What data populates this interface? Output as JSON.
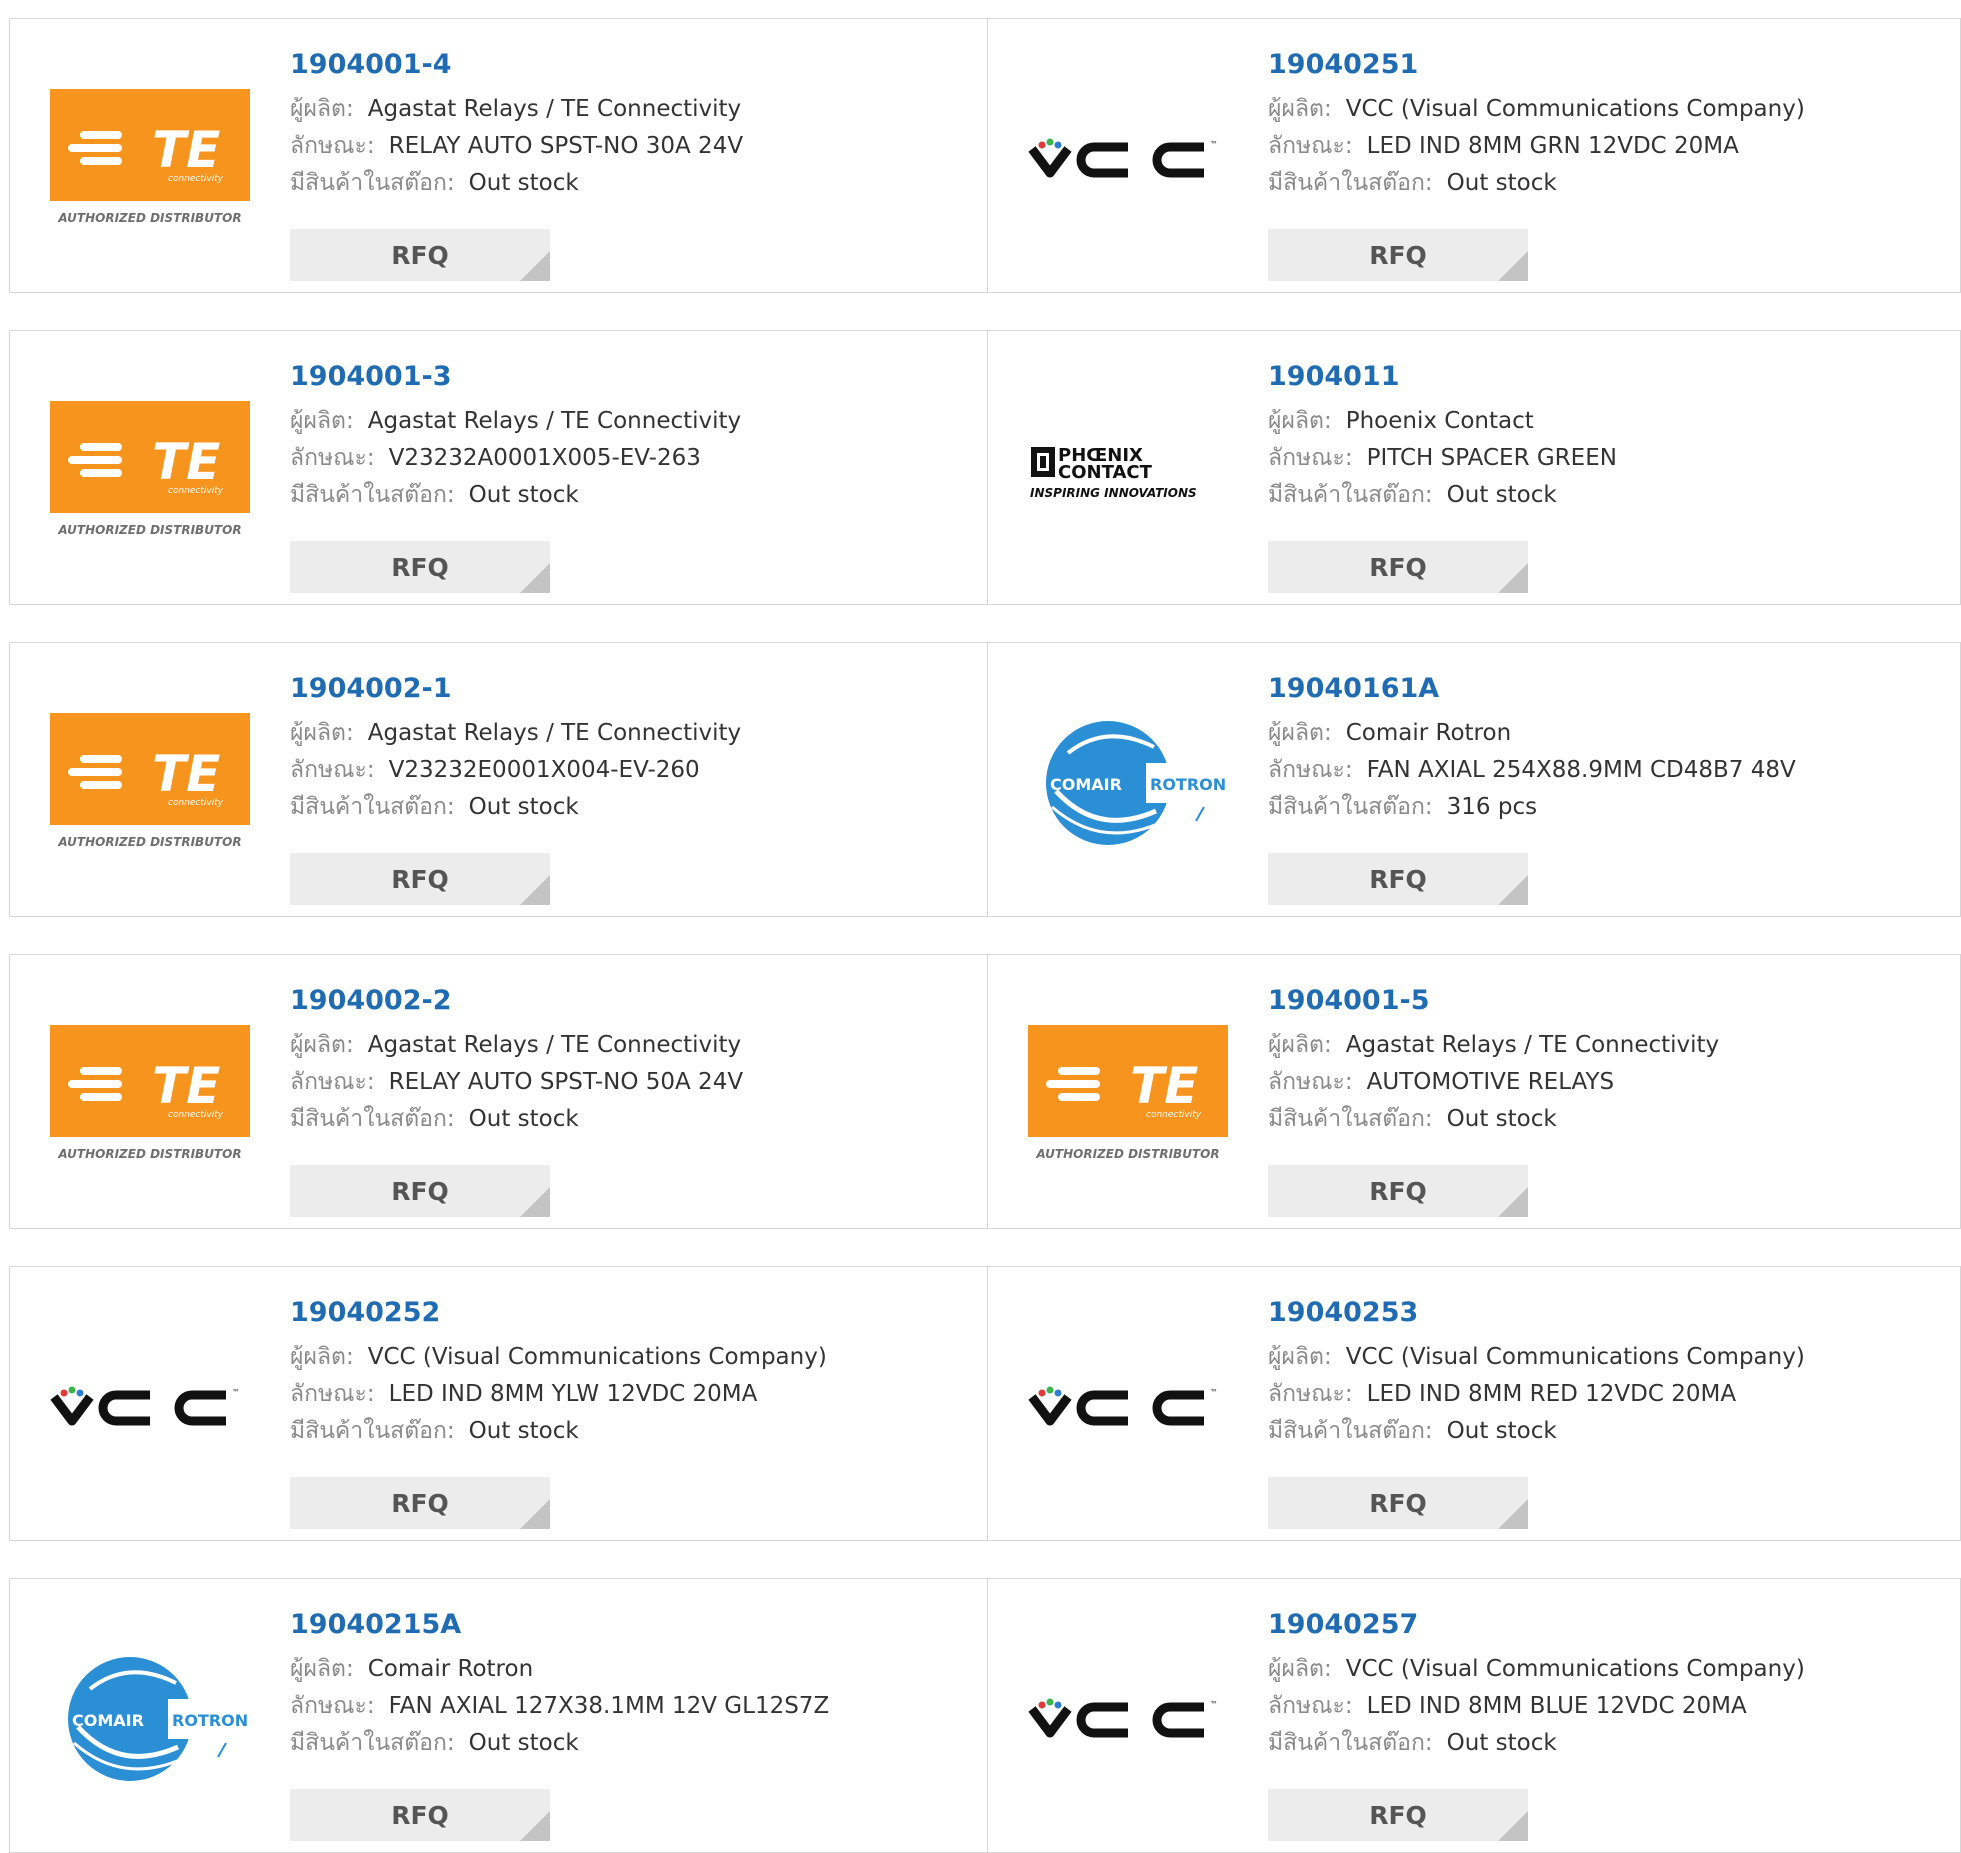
{
  "labels": {
    "manufacturer": "ผู้ผลิต:",
    "description": "ลักษณะ:",
    "stock": "มีสินค้าในสต๊อก:",
    "rfq": "RFQ"
  },
  "brands": {
    "te": {
      "name": "TE",
      "sub": "connectivity",
      "tagline": "AUTHORIZED DISTRIBUTOR",
      "color": "#f7941d"
    },
    "vcc": {
      "name": "VCC",
      "tm": "™"
    },
    "phoenix": {
      "line1": "PHŒNIX",
      "line2": "CONTACT",
      "tagline": "INSPIRING INNOVATIONS"
    },
    "comair": {
      "left": "COMAIR",
      "right": "ROTRON",
      "color": "#2b8fd6"
    }
  },
  "rows": [
    [
      {
        "part": "1904001-4",
        "logo": "te",
        "manufacturer": "Agastat Relays / TE Connectivity",
        "description": "RELAY AUTO SPST-NO 30A 24V",
        "stock": "Out stock"
      },
      {
        "part": "19040251",
        "logo": "vcc",
        "manufacturer": "VCC (Visual Communications Company)",
        "description": "LED IND 8MM GRN 12VDC 20MA",
        "stock": "Out stock"
      }
    ],
    [
      {
        "part": "1904001-3",
        "logo": "te",
        "manufacturer": "Agastat Relays / TE Connectivity",
        "description": "V23232A0001X005-EV-263",
        "stock": "Out stock"
      },
      {
        "part": "1904011",
        "logo": "phoenix",
        "manufacturer": "Phoenix Contact",
        "description": "PITCH SPACER GREEN",
        "stock": "Out stock"
      }
    ],
    [
      {
        "part": "1904002-1",
        "logo": "te",
        "manufacturer": "Agastat Relays / TE Connectivity",
        "description": "V23232E0001X004-EV-260",
        "stock": "Out stock"
      },
      {
        "part": "19040161A",
        "logo": "comair",
        "manufacturer": "Comair Rotron",
        "description": "FAN AXIAL 254X88.9MM CD48B7 48V",
        "stock": "316 pcs"
      }
    ],
    [
      {
        "part": "1904002-2",
        "logo": "te",
        "manufacturer": "Agastat Relays / TE Connectivity",
        "description": "RELAY AUTO SPST-NO 50A 24V",
        "stock": "Out stock"
      },
      {
        "part": "1904001-5",
        "logo": "te",
        "manufacturer": "Agastat Relays / TE Connectivity",
        "description": "AUTOMOTIVE RELAYS",
        "stock": "Out stock"
      }
    ],
    [
      {
        "part": "19040252",
        "logo": "vcc",
        "manufacturer": "VCC (Visual Communications Company)",
        "description": "LED IND 8MM YLW 12VDC 20MA",
        "stock": "Out stock"
      },
      {
        "part": "19040253",
        "logo": "vcc",
        "manufacturer": "VCC (Visual Communications Company)",
        "description": "LED IND 8MM RED 12VDC 20MA",
        "stock": "Out stock"
      }
    ],
    [
      {
        "part": "19040215A",
        "logo": "comair",
        "manufacturer": "Comair Rotron",
        "description": "FAN AXIAL 127X38.1MM 12V GL12S7Z",
        "stock": "Out stock"
      },
      {
        "part": "19040257",
        "logo": "vcc",
        "manufacturer": "VCC (Visual Communications Company)",
        "description": "LED IND 8MM BLUE 12VDC 20MA",
        "stock": "Out stock"
      }
    ]
  ]
}
